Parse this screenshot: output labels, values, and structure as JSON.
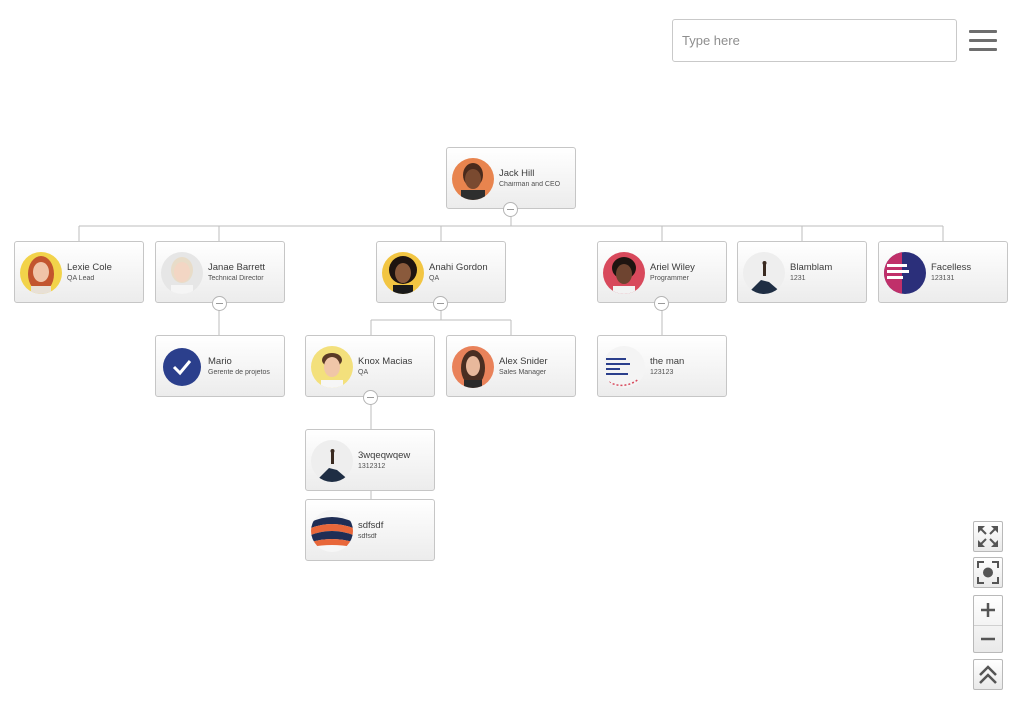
{
  "search": {
    "placeholder": "Type here"
  },
  "menu": {
    "icon": "hamburger-icon"
  },
  "nodes": [
    {
      "name": "Jack Hill",
      "title": "Chairman and CEO",
      "avatar": "photo"
    },
    {
      "name": "Lexie Cole",
      "title": "QA Lead",
      "avatar": "photo"
    },
    {
      "name": "Janae Barrett",
      "title": "Technical Director",
      "avatar": "photo"
    },
    {
      "name": "Anahi Gordon",
      "title": "QA",
      "avatar": "photo"
    },
    {
      "name": "Ariel Wiley",
      "title": "Programmer",
      "avatar": "photo"
    },
    {
      "name": "Blamblam",
      "title": "1231",
      "avatar": "image"
    },
    {
      "name": "Facelless",
      "title": "123131",
      "avatar": "image"
    },
    {
      "name": "Mario",
      "title": "Gerente de projetos",
      "avatar": "check-icon"
    },
    {
      "name": "Knox Macias",
      "title": "QA",
      "avatar": "photo"
    },
    {
      "name": "Alex Snider",
      "title": "Sales Manager",
      "avatar": "photo"
    },
    {
      "name": "the man",
      "title": "123123",
      "avatar": "image"
    },
    {
      "name": "3wqeqwqew",
      "title": "1312312",
      "avatar": "image"
    },
    {
      "name": "sdfsdf",
      "title": "sdfsdf",
      "avatar": "image"
    }
  ],
  "controls": {
    "fit": "expand-arrows-icon",
    "focus": "focus-frame-icon",
    "zoom_in": "plus-icon",
    "zoom_out": "minus-icon",
    "top": "double-chevron-up-icon"
  },
  "colors": {
    "accent": "#2b3f8c",
    "line": "#bdbdbd",
    "node_border": "#c6c6c6"
  }
}
